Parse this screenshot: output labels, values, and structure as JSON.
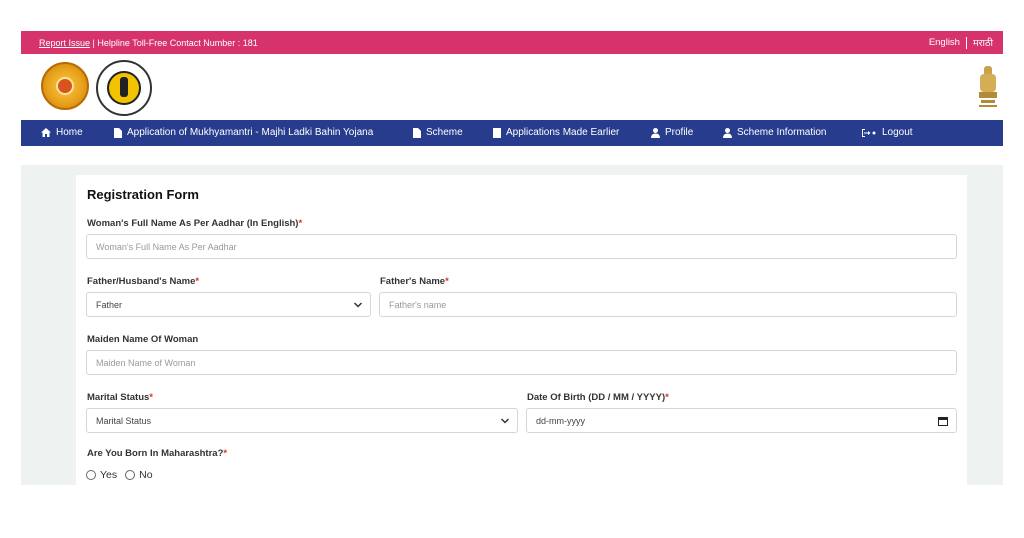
{
  "topbar": {
    "report_issue": "Report Issue",
    "helpline": "| Helpline Toll-Free Contact Number : 181",
    "lang_english": "English",
    "lang_marathi": "मराठी"
  },
  "nav": {
    "home": "Home",
    "application": "Application of Mukhyamantri - Majhi Ladki Bahin Yojana",
    "scheme": "Scheme",
    "applications_earlier": "Applications Made Earlier",
    "profile": "Profile",
    "scheme_information": "Scheme Information",
    "logout": "Logout"
  },
  "form": {
    "title": "Registration Form",
    "full_name": {
      "label": "Woman's Full Name As Per Aadhar (In English)",
      "placeholder": "Woman's Full Name As Per Aadhar",
      "required": "*"
    },
    "relation": {
      "label": "Father/Husband's Name",
      "value": "Father",
      "required": "*"
    },
    "father_name": {
      "label": "Father's Name",
      "placeholder": "Father's name",
      "required": "*"
    },
    "maiden_name": {
      "label": "Maiden Name Of Woman",
      "placeholder": "Maiden Name of Woman"
    },
    "marital_status": {
      "label": "Marital Status",
      "value": "Marital Status",
      "required": "*"
    },
    "dob": {
      "label": "Date Of Birth (DD / MM / YYYY)",
      "placeholder": "dd-mm-yyyy",
      "required": "*"
    },
    "born_maharashtra": {
      "label": "Are You Born In Maharashtra?",
      "required": "*",
      "yes": "Yes",
      "no": "No"
    }
  },
  "colors": {
    "topbar": "#d6336c",
    "navbar": "#283c8e",
    "required": "#d9302f"
  }
}
